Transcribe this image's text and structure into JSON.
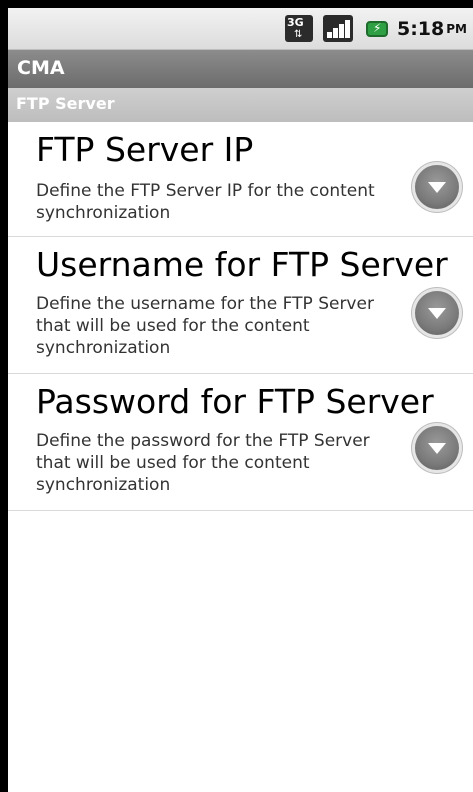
{
  "status_bar": {
    "network_label": "3G",
    "time": "5:18",
    "ampm": "PM"
  },
  "app": {
    "title": "CMA"
  },
  "category": {
    "title": "FTP Server"
  },
  "preferences": [
    {
      "title": "FTP Server IP",
      "summary_lines": [
        "Define the FTP Server IP for the content",
        "synchronization"
      ]
    },
    {
      "title": "Username for FTP Server",
      "summary_lines": [
        "Define the username for the FTP Server",
        "that will be used for the content",
        "synchronization"
      ]
    },
    {
      "title": "Password for FTP Server",
      "summary_lines": [
        "Define the password for the FTP Server",
        "that will be used for the content",
        "synchronization"
      ]
    }
  ]
}
